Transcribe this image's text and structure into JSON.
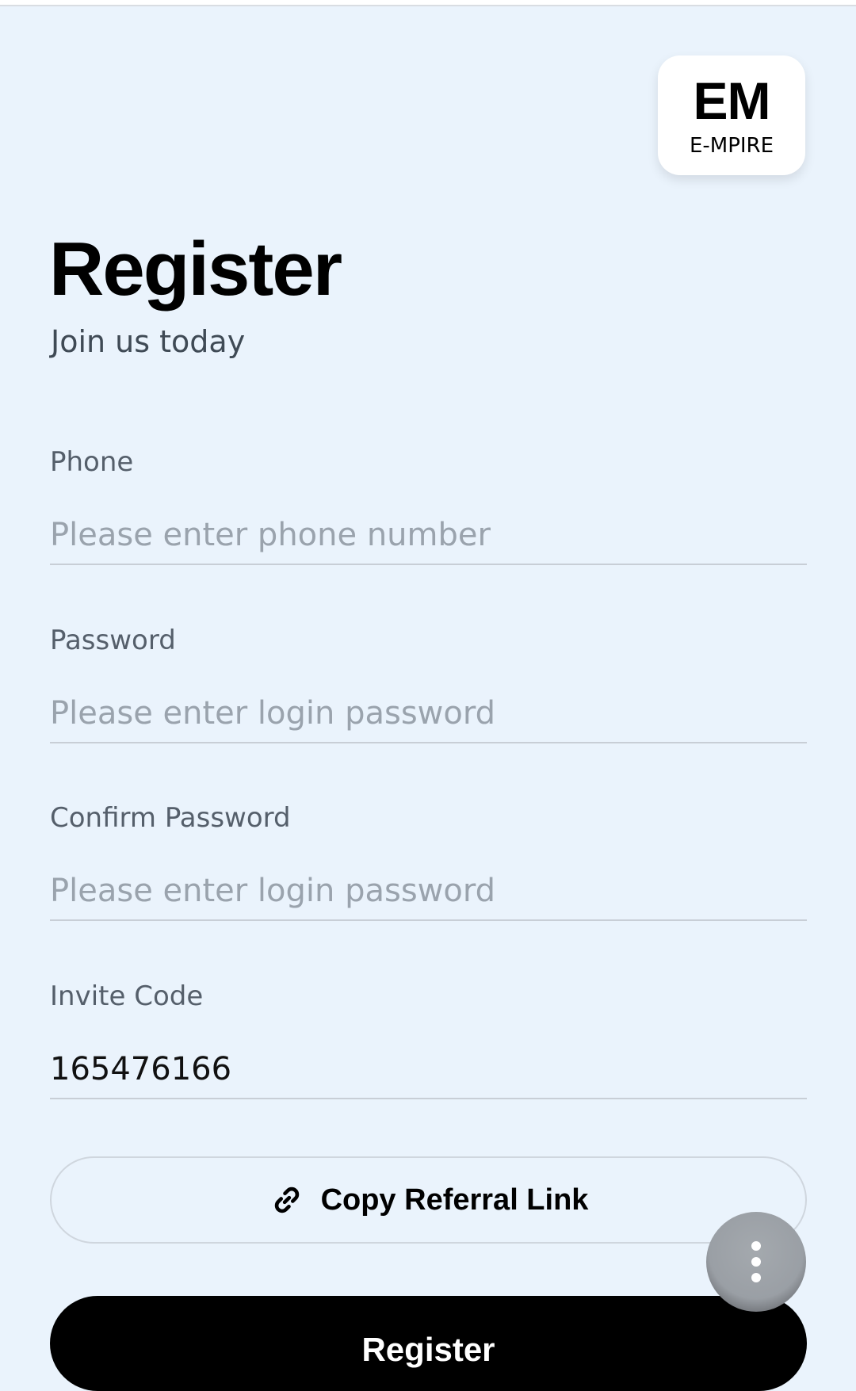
{
  "logo": {
    "main": "EM",
    "sub": "E-MPIRE"
  },
  "header": {
    "title": "Register",
    "subtitle": "Join us today"
  },
  "form": {
    "phone": {
      "label": "Phone",
      "placeholder": "Please enter phone number",
      "value": ""
    },
    "password": {
      "label": "Password",
      "placeholder": "Please enter login password",
      "value": ""
    },
    "confirm_password": {
      "label": "Confirm Password",
      "placeholder": "Please enter login password",
      "value": ""
    },
    "invite_code": {
      "label": "Invite Code",
      "placeholder": "",
      "value": "165476166"
    }
  },
  "actions": {
    "copy_referral_label": "Copy Referral Link",
    "copy_referral_icon": "link-icon",
    "register_label": "Register",
    "more_icon": "more-vertical-icon"
  }
}
